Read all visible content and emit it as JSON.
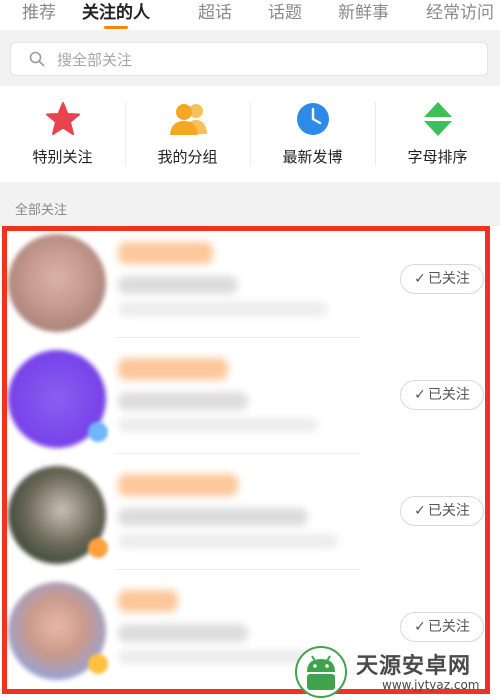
{
  "tabs": [
    {
      "label": "推荐"
    },
    {
      "label": "关注的人"
    },
    {
      "label": "超话"
    },
    {
      "label": "话题"
    },
    {
      "label": "新鲜事"
    },
    {
      "label": "经常访问"
    }
  ],
  "search": {
    "placeholder": "搜全部关注",
    "icon": "search-icon"
  },
  "actions": [
    {
      "label": "特别关注",
      "icon": "star-icon",
      "color": "#e8444f"
    },
    {
      "label": "我的分组",
      "icon": "group-icon",
      "color": "#f5a623"
    },
    {
      "label": "最新发博",
      "icon": "clock-icon",
      "color": "#2d8be8"
    },
    {
      "label": "字母排序",
      "icon": "sort-icon",
      "color": "#3fbf5a"
    }
  ],
  "section": {
    "title": "全部关注"
  },
  "follow_label": "已关注",
  "highlight_color": "#f0321e",
  "watermark": {
    "name": "天源安卓网",
    "url": "www.jytyaz.com"
  }
}
